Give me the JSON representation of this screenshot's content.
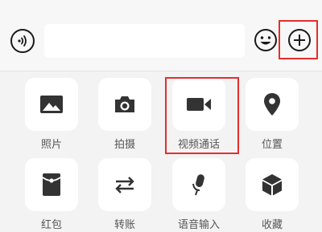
{
  "input_bar": {
    "text_value": "",
    "voice_icon": "voice-icon",
    "emoji_icon": "emoji-icon",
    "more_icon": "plus-circle-icon"
  },
  "panel": {
    "row1": [
      {
        "label": "照片",
        "icon": "photo-icon"
      },
      {
        "label": "拍摄",
        "icon": "camera-icon"
      },
      {
        "label": "视频通话",
        "icon": "video-call-icon"
      },
      {
        "label": "位置",
        "icon": "location-icon"
      }
    ],
    "row2": [
      {
        "label": "红包",
        "icon": "red-packet-icon"
      },
      {
        "label": "转账",
        "icon": "transfer-icon"
      },
      {
        "label": "语音输入",
        "icon": "microphone-icon"
      },
      {
        "label": "收藏",
        "icon": "favorites-icon"
      }
    ]
  },
  "colors": {
    "highlight": "#e52d2d",
    "icon": "#333333",
    "label": "#555555",
    "panel_bg": "#f3f3f3",
    "tile_bg": "#ffffff"
  }
}
